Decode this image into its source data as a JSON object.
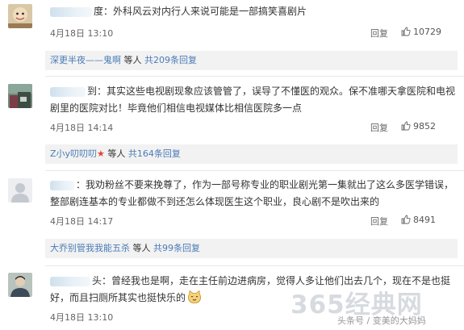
{
  "colors": {
    "link": "#4a7bb7",
    "text": "#333333",
    "meta": "#666666",
    "reply_bg": "#f2f2f2",
    "star": "#e8402f"
  },
  "comments": [
    {
      "avatar_icon": "avatar-face-icon",
      "name_suffix": "度",
      "text": "：外科风云对内行人来说可能是一部搞笑喜剧片",
      "time": "4月18日 13:10",
      "reply_label": "回复",
      "like_icon": "thumbs-up-icon",
      "likes": "10729",
      "replies": {
        "author": "深更半夜——鬼啊",
        "mid": " 等人 ",
        "count": "共209条回复"
      }
    },
    {
      "avatar_icon": "avatar-photo-icon",
      "name_suffix": "到",
      "text": "：其实这些电视剧现象应该管管了，误导了不懂医的观众。保不准哪天拿医院和电视剧里的医院对比！毕竟他们相信电视媒体比相信医院多一点",
      "time": "4月18日 14:14",
      "reply_label": "回复",
      "like_icon": "thumbs-up-icon",
      "likes": "9852",
      "replies": {
        "author": "Z小y叨叨叨",
        "star": "★",
        "mid": " 等人 ",
        "count": "共164条回复"
      }
    },
    {
      "avatar_icon": "avatar-default-icon",
      "name_suffix": "",
      "text": "：我劝粉丝不要来挽尊了，作为一部号称专业的职业剧光第一集就出了这么多医学错误，整部剧连基本的专业都做不到还怎么体现医生这个职业，良心剧不是吹出来的",
      "time": "4月18日 14:17",
      "reply_label": "回复",
      "like_icon": "thumbs-up-icon",
      "likes": "8491",
      "replies": {
        "author": "大乔别管我我能五杀",
        "mid": " 等人 ",
        "count": "共99条回复"
      }
    },
    {
      "avatar_icon": "avatar-person-icon",
      "name_suffix": "头",
      "text": "：曾经我也是啊，走在主任前边进病房，觉得人多让他们出去几个，现在不是也挺好，而且扫厕所其实也挺快乐的",
      "emoji": "cat-face-emoji-icon",
      "time": "4月18日 13:10"
    }
  ],
  "watermark": {
    "logo_text": "365经典网",
    "credit": "头条号 / 变美的大妈妈"
  }
}
